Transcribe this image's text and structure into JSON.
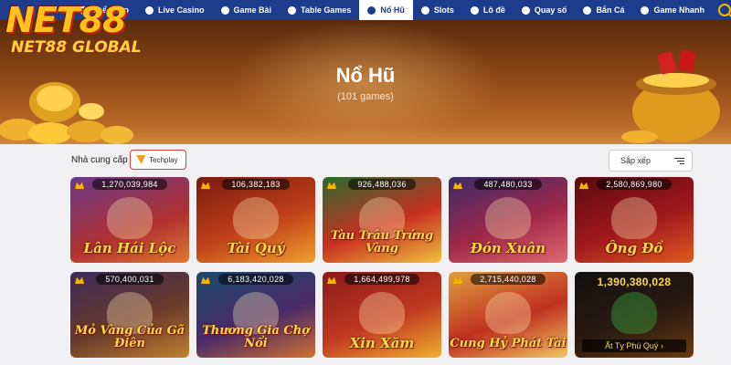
{
  "logo": {
    "main": "NET88",
    "sub": "NET88 GLOBAL"
  },
  "nav": {
    "items": [
      {
        "label": "Thể Thao",
        "icon": "sports-icon"
      },
      {
        "label": "Live Casino",
        "icon": "casino-icon"
      },
      {
        "label": "Game Bài",
        "icon": "cards-icon"
      },
      {
        "label": "Table Games",
        "icon": "table-icon"
      },
      {
        "label": "Nổ Hũ",
        "icon": "jackpot-pot-icon",
        "active": true
      },
      {
        "label": "Slots",
        "icon": "slots-icon"
      },
      {
        "label": "Lô đề",
        "icon": "lottery-icon"
      },
      {
        "label": "Quay số",
        "icon": "spin-icon"
      },
      {
        "label": "Bắn Cá",
        "icon": "fish-icon"
      },
      {
        "label": "Game Nhanh",
        "icon": "rocket-icon"
      }
    ],
    "search_icon": "search-icon"
  },
  "banner": {
    "title": "Nổ Hũ",
    "count": "(101 games)"
  },
  "filters": {
    "provider_label": "Nhà cung cấp",
    "provider_chip": "Techplay",
    "sort_label": "Sắp xếp"
  },
  "colors": {
    "nav_bg": "#1e3c8c",
    "accent": "#ffc21a",
    "chip_border": "#d04040"
  },
  "games": [
    {
      "jackpot": "1,270,039,984",
      "name": "Lân Hái Lộc"
    },
    {
      "jackpot": "106,382,183",
      "name": "Tài Quý"
    },
    {
      "jackpot": "926,488,036",
      "name": "Tàu Trâu Trứng Vàng"
    },
    {
      "jackpot": "487,480,033",
      "name": "Đón Xuân"
    },
    {
      "jackpot": "2,580,869,980",
      "name": "Ông Đồ"
    },
    {
      "jackpot": "570,400,031",
      "name": "Mỏ Vàng Của Gã Điên"
    },
    {
      "jackpot": "6,183,420,028",
      "name": "Thương Gia Chợ Nổi"
    },
    {
      "jackpot": "1,664,499,978",
      "name": "Xin Xăm"
    },
    {
      "jackpot": "2,715,440,028",
      "name": "Cung Hỷ Phát Tài"
    },
    {
      "jackpot": "1,390,380,028",
      "name": "",
      "cta": "Ất Tỵ Phú Quý"
    }
  ]
}
